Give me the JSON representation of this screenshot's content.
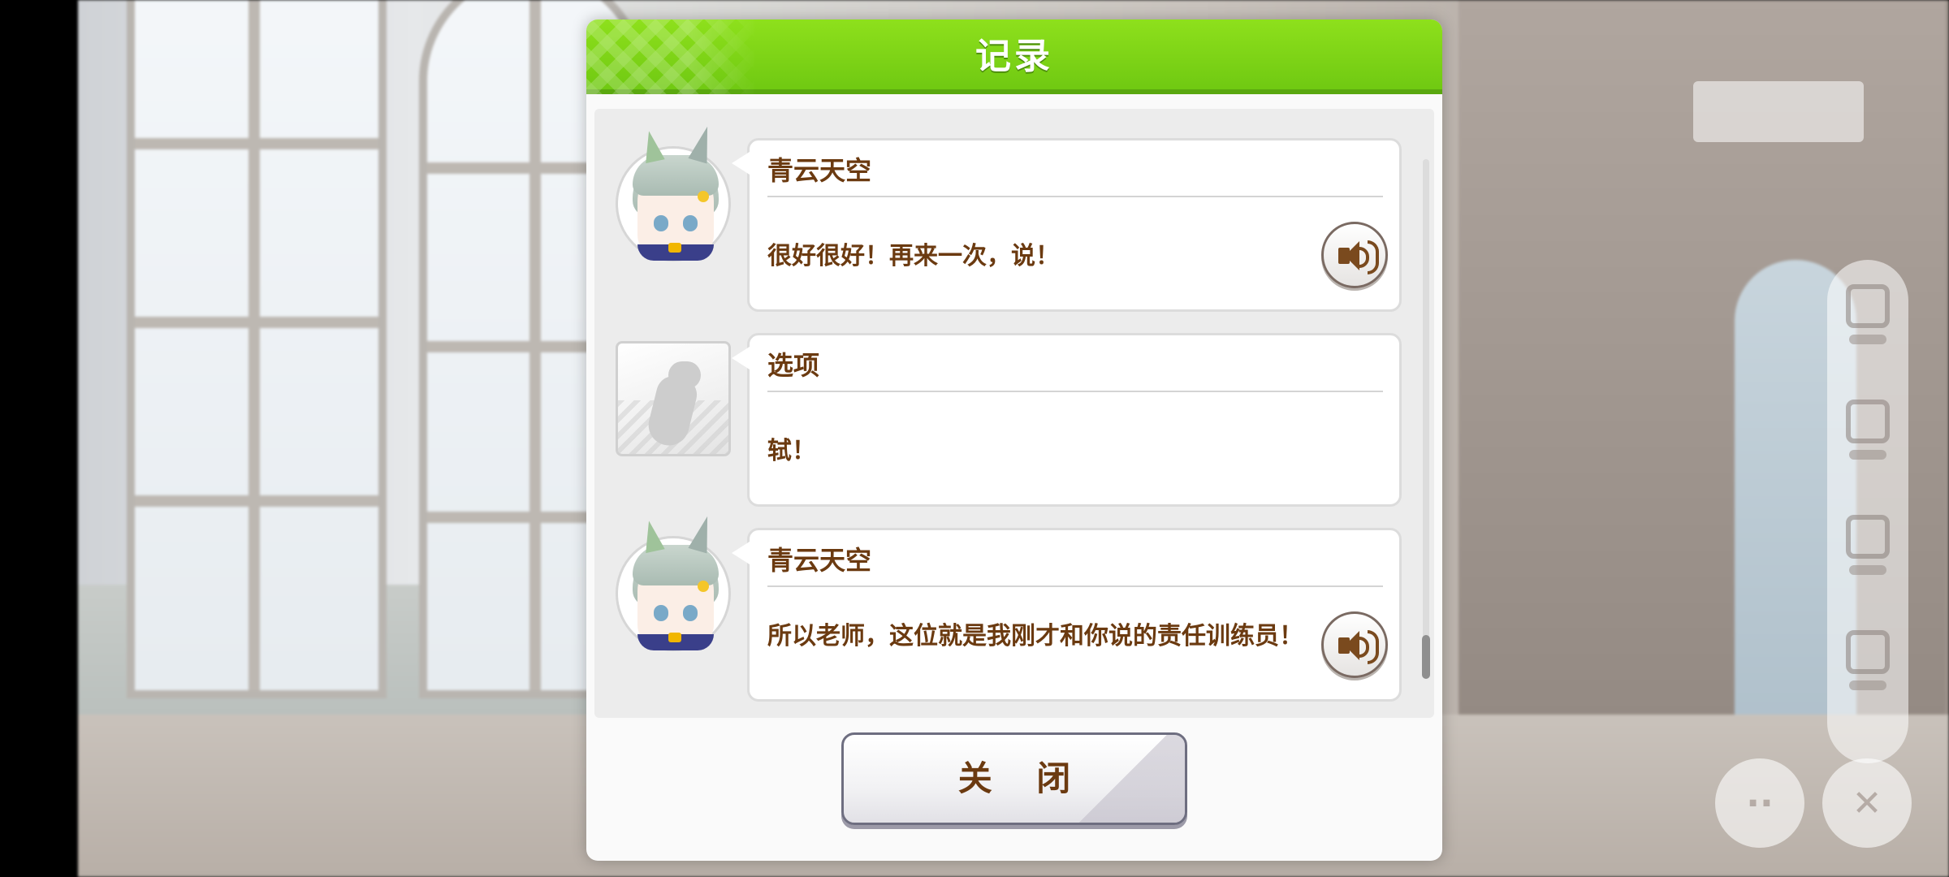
{
  "dialog": {
    "title": "记录",
    "close_label": "关 闭"
  },
  "log": [
    {
      "speaker": "青云天空",
      "text": "很好很好！再来一次，说！",
      "icon": "character-portrait",
      "has_voice": true
    },
    {
      "speaker": "选项",
      "text": "轼！",
      "icon": "carrot-icon",
      "has_voice": false
    },
    {
      "speaker": "青云天空",
      "text": "所以老师，这位就是我刚才和你说的责任训练员！",
      "icon": "character-portrait",
      "has_voice": true
    }
  ],
  "icons": {
    "voice": "speaker-icon",
    "side_menu": [
      "menu-icon",
      "copy-icon",
      "log-icon",
      "fullscreen-icon"
    ],
    "close_x": "close-icon"
  },
  "colors": {
    "header_green": "#7ad317",
    "text_brown": "#6b3a10"
  }
}
